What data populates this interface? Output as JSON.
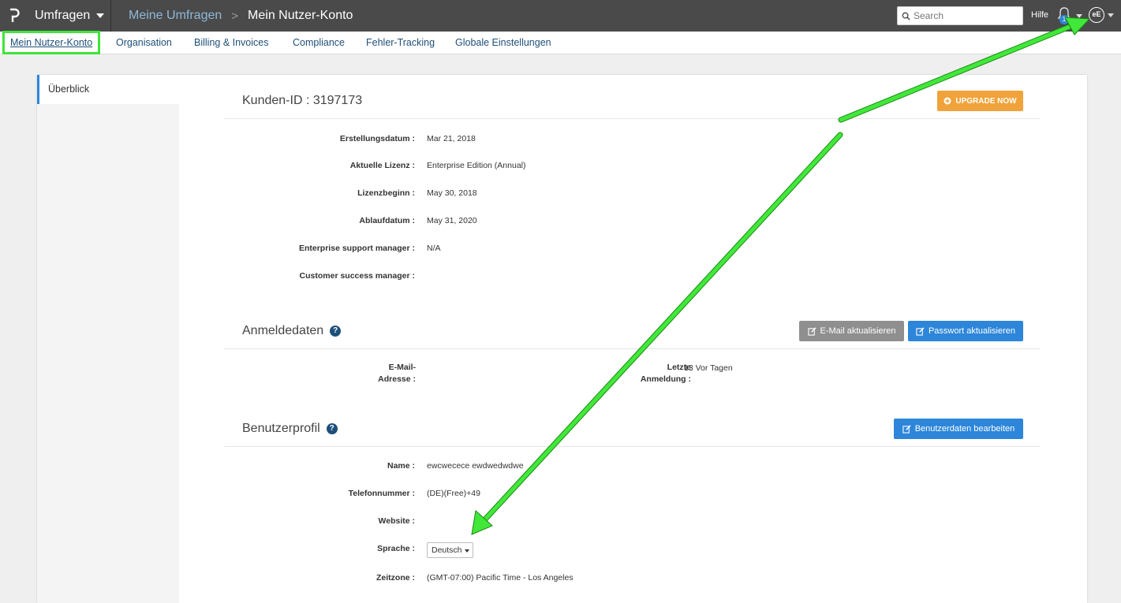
{
  "topbar": {
    "logo_icon": "p-logo-icon",
    "app_name": "Umfragen",
    "breadcrumb_parent": "Meine Umfragen",
    "breadcrumb_sep": ">",
    "breadcrumb_current": "Mein Nutzer-Konto",
    "search_placeholder": "Search",
    "help": "Hilfe",
    "notification_count": "1",
    "avatar_initials": "eE"
  },
  "subnav": {
    "items": [
      {
        "label": "Mein Nutzer-Konto",
        "active": true
      },
      {
        "label": "Organisation"
      },
      {
        "label": "Billing & Invoices"
      },
      {
        "label": "Compliance"
      },
      {
        "label": "Fehler-Tracking"
      },
      {
        "label": "Globale Einstellungen"
      }
    ]
  },
  "sidebar": {
    "items": [
      {
        "label": "Überblick"
      }
    ]
  },
  "account": {
    "title": "Kunden-ID : 3197173",
    "upgrade_button": "UPGRADE NOW",
    "fields": [
      {
        "label": "Erstellungsdatum :",
        "value": "Mar 21, 2018"
      },
      {
        "label": "Aktuelle Lizenz :",
        "value": "Enterprise Edition (Annual)"
      },
      {
        "label": "Lizenzbeginn :",
        "value": "May 30, 2018"
      },
      {
        "label": "Ablaufdatum :",
        "value": "May 31, 2020"
      },
      {
        "label": "Enterprise support manager :",
        "value": "N/A"
      },
      {
        "label": "Customer success manager :",
        "value": ""
      }
    ]
  },
  "login": {
    "title": "Anmeldedaten",
    "update_email_button": "E-Mail aktualisieren",
    "update_password_button": "Passwort aktualisieren",
    "email_label_line1": "E-Mail-",
    "email_label_line2": "Adresse :",
    "email_value": "",
    "last_login_label_line1": "Letzte",
    "last_login_label_line2": "Anmeldung :",
    "last_login_value": "13 Vor Tagen"
  },
  "profile": {
    "title": "Benutzerprofil",
    "edit_button": "Benutzerdaten bearbeiten",
    "fields": [
      {
        "label": "Name :",
        "value": "ewcwecece ewdwedwdwe"
      },
      {
        "label": "Telefonnummer :",
        "value": "(DE)(Free)+49"
      },
      {
        "label": "Website :",
        "value": ""
      },
      {
        "label": "Sprache :",
        "value": "Deutsch"
      },
      {
        "label": "Zeitzone :",
        "value": "(GMT-07:00) Pacific Time - Los Angeles"
      }
    ]
  },
  "colors": {
    "topbar_bg": "#4a4a4a",
    "accent_blue": "#2d86d9",
    "upgrade_orange": "#f0a33a",
    "highlight_green": "#3fe53a",
    "nav_link": "#1e4f7a"
  }
}
